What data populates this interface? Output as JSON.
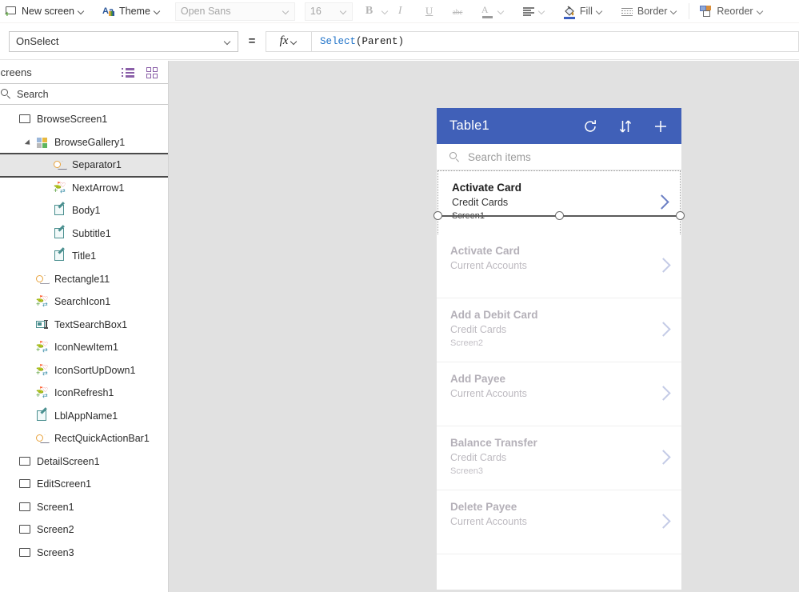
{
  "toolbar": {
    "new_screen": "New screen",
    "theme": "Theme",
    "font_family": "Open Sans",
    "font_size": "16",
    "bold": "B",
    "italic": "I",
    "underline": "U",
    "strikethrough": "abc",
    "font_color": "A",
    "align": "align",
    "fill": "Fill",
    "border": "Border",
    "reorder": "Reorder"
  },
  "formula_bar": {
    "property": "OnSelect",
    "equals": "=",
    "fx": "fx",
    "formula_fn": "Select",
    "formula_args": "(Parent)"
  },
  "sidebar": {
    "title": "Screens",
    "tree_view_icon": "tree-view-icon",
    "thumbnail_view_icon": "thumbnail-view-icon",
    "search_placeholder": "Search",
    "tree": [
      {
        "label": "BrowseScreen1",
        "icon": "screen",
        "indent": 0,
        "expander": "none",
        "selected": false
      },
      {
        "label": "BrowseGallery1",
        "icon": "gallery",
        "indent": 1,
        "expander": "open",
        "selected": false
      },
      {
        "label": "Separator1",
        "icon": "shape",
        "indent": 2,
        "expander": "none",
        "selected": true
      },
      {
        "label": "NextArrow1",
        "icon": "control",
        "indent": 2,
        "expander": "none",
        "selected": false
      },
      {
        "label": "Body1",
        "icon": "label",
        "indent": 2,
        "expander": "none",
        "selected": false
      },
      {
        "label": "Subtitle1",
        "icon": "label",
        "indent": 2,
        "expander": "none",
        "selected": false
      },
      {
        "label": "Title1",
        "icon": "label",
        "indent": 2,
        "expander": "none",
        "selected": false
      },
      {
        "label": "Rectangle11",
        "icon": "shape",
        "indent": 1,
        "expander": "none",
        "selected": false
      },
      {
        "label": "SearchIcon1",
        "icon": "control",
        "indent": 1,
        "expander": "none",
        "selected": false
      },
      {
        "label": "TextSearchBox1",
        "icon": "textbox",
        "indent": 1,
        "expander": "none",
        "selected": false
      },
      {
        "label": "IconNewItem1",
        "icon": "control",
        "indent": 1,
        "expander": "none",
        "selected": false
      },
      {
        "label": "IconSortUpDown1",
        "icon": "control",
        "indent": 1,
        "expander": "none",
        "selected": false
      },
      {
        "label": "IconRefresh1",
        "icon": "control",
        "indent": 1,
        "expander": "none",
        "selected": false
      },
      {
        "label": "LblAppName1",
        "icon": "label",
        "indent": 1,
        "expander": "none",
        "selected": false
      },
      {
        "label": "RectQuickActionBar1",
        "icon": "shape",
        "indent": 1,
        "expander": "none",
        "selected": false
      },
      {
        "label": "DetailScreen1",
        "icon": "screen",
        "indent": 0,
        "expander": "none",
        "selected": false
      },
      {
        "label": "EditScreen1",
        "icon": "screen",
        "indent": 0,
        "expander": "none",
        "selected": false
      },
      {
        "label": "Screen1",
        "icon": "screen",
        "indent": 0,
        "expander": "none",
        "selected": false
      },
      {
        "label": "Screen2",
        "icon": "screen",
        "indent": 0,
        "expander": "none",
        "selected": false
      },
      {
        "label": "Screen3",
        "icon": "screen",
        "indent": 0,
        "expander": "none",
        "selected": false
      }
    ]
  },
  "app_preview": {
    "header_color": "#4060b8",
    "title": "Table1",
    "refresh_icon": "refresh-icon",
    "sort_icon": "sort-updown-icon",
    "add_icon": "plus-icon",
    "search_placeholder": "Search items",
    "gallery_items": [
      {
        "title": "Activate Card",
        "subtitle": "Credit Cards",
        "body": "Screen1",
        "state": "active"
      },
      {
        "title": "Activate Card",
        "subtitle": "Current Accounts",
        "body": "",
        "state": "dim"
      },
      {
        "title": "Add a Debit Card",
        "subtitle": "Credit Cards",
        "body": "Screen2",
        "state": "dim"
      },
      {
        "title": "Add Payee",
        "subtitle": "Current Accounts",
        "body": "",
        "state": "dim"
      },
      {
        "title": "Balance Transfer",
        "subtitle": "Credit Cards",
        "body": "Screen3",
        "state": "dim"
      },
      {
        "title": "Delete Payee",
        "subtitle": "Current Accounts",
        "body": "",
        "state": "dim"
      }
    ]
  }
}
